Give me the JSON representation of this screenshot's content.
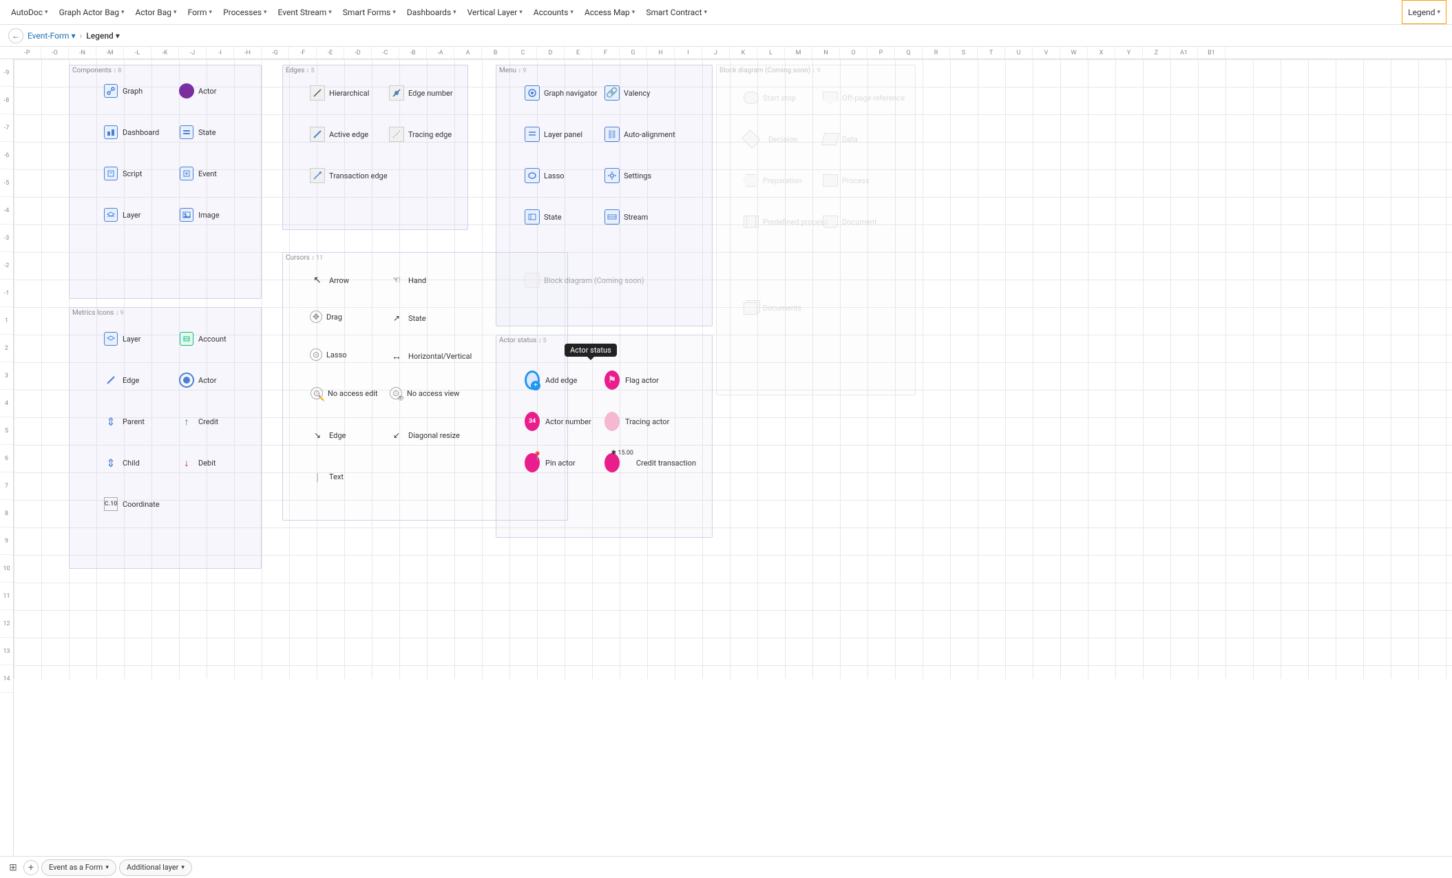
{
  "nav": {
    "items": [
      {
        "label": "AutoDoc",
        "id": "autodoc"
      },
      {
        "label": "Graph Actor Bag",
        "id": "graph-actor-bag"
      },
      {
        "label": "Actor Bag",
        "id": "actor-bag"
      },
      {
        "label": "Form",
        "id": "form"
      },
      {
        "label": "Processes",
        "id": "processes"
      },
      {
        "label": "Event Stream",
        "id": "event-stream"
      },
      {
        "label": "Smart Forms",
        "id": "smart-forms"
      },
      {
        "label": "Dashboards",
        "id": "dashboards"
      },
      {
        "label": "Vertical Layer",
        "id": "vertical-layer"
      },
      {
        "label": "Accounts",
        "id": "accounts"
      },
      {
        "label": "Access Map",
        "id": "access-map"
      },
      {
        "label": "Smart Contract",
        "id": "smart-contract"
      },
      {
        "label": "Legend",
        "id": "legend",
        "active": true
      }
    ]
  },
  "breadcrumb": {
    "back_label": "←",
    "parent": "Event-Form",
    "current": "Legend"
  },
  "columns": [
    "-P",
    "-O",
    "-N",
    "-M",
    "-L",
    "-K",
    "-J",
    "-I",
    "-H",
    "-G",
    "-F",
    "-E",
    "-D",
    "-C",
    "-B",
    "-A",
    "A",
    "B",
    "C",
    "D",
    "E",
    "F",
    "G",
    "H",
    "I",
    "J",
    "K",
    "L",
    "M",
    "N",
    "O",
    "P",
    "Q",
    "R",
    "S",
    "T",
    "U",
    "V",
    "W",
    "X",
    "Y",
    "Z",
    "A1",
    "B1"
  ],
  "rows": [
    "-9",
    "-8",
    "-7",
    "-6",
    "-5",
    "-4",
    "-3",
    "-2",
    "-1",
    "1",
    "2",
    "3",
    "4",
    "5",
    "6",
    "7",
    "8",
    "9",
    "10",
    "11",
    "12",
    "13",
    "14"
  ],
  "sections": {
    "components": {
      "title": "Components",
      "num": "8",
      "items": [
        {
          "icon": "graph",
          "label": "Graph"
        },
        {
          "icon": "actor-purple",
          "label": "Actor"
        },
        {
          "icon": "dashboard",
          "label": "Dashboard"
        },
        {
          "icon": "state",
          "label": "State"
        },
        {
          "icon": "script",
          "label": "Script"
        },
        {
          "icon": "event",
          "label": "Event"
        },
        {
          "icon": "layer",
          "label": "Layer"
        },
        {
          "icon": "image",
          "label": "Image"
        }
      ]
    },
    "edges": {
      "title": "Edges",
      "num": "5",
      "items": [
        {
          "icon": "hierarchical",
          "label": "Hierarchical"
        },
        {
          "icon": "edge-number",
          "label": "Edge number"
        },
        {
          "icon": "active-edge",
          "label": "Active edge"
        },
        {
          "icon": "tracing-edge",
          "label": "Tracing edge"
        },
        {
          "icon": "transaction-edge",
          "label": "Transaction edge"
        }
      ]
    },
    "menu": {
      "title": "Menu",
      "num": "9",
      "items": [
        {
          "icon": "graph-navigator",
          "label": "Graph navigator"
        },
        {
          "icon": "valency",
          "label": "Valency"
        },
        {
          "icon": "layer-panel",
          "label": "Layer panel"
        },
        {
          "icon": "auto-alignment",
          "label": "Auto-alignment"
        },
        {
          "icon": "lasso",
          "label": "Lasso"
        },
        {
          "icon": "settings",
          "label": "Settings"
        },
        {
          "icon": "state-menu",
          "label": "State"
        },
        {
          "icon": "stream",
          "label": "Stream"
        },
        {
          "icon": "block-diagram-coming",
          "label": "Block diagram (Coming soon)"
        }
      ]
    },
    "block_diagram": {
      "title": "Block diagram (Coming soon)",
      "num": "9",
      "items": [
        {
          "label": "Start stop"
        },
        {
          "label": "Off-page reference"
        },
        {
          "label": "Decision"
        },
        {
          "label": "Data"
        },
        {
          "label": "Preparation"
        },
        {
          "label": "Process"
        },
        {
          "label": "Predefined process"
        },
        {
          "label": "Document"
        },
        {
          "label": "Documents"
        }
      ]
    },
    "metrics": {
      "title": "Metrics Icons",
      "num": "9",
      "items": [
        {
          "icon": "layer-m",
          "label": "Layer"
        },
        {
          "icon": "account",
          "label": "Account"
        },
        {
          "icon": "edge-m",
          "label": "Edge"
        },
        {
          "icon": "actor-m",
          "label": "Actor"
        },
        {
          "icon": "parent",
          "label": "Parent"
        },
        {
          "icon": "credit",
          "label": "Credit"
        },
        {
          "icon": "child",
          "label": "Child"
        },
        {
          "icon": "debit",
          "label": "Debit"
        },
        {
          "icon": "coordinate",
          "label": "Coordinate"
        }
      ]
    },
    "cursors": {
      "title": "Cursors",
      "num": "11",
      "items": [
        {
          "icon": "arrow",
          "label": "Arrow"
        },
        {
          "icon": "hand",
          "label": "Hand"
        },
        {
          "icon": "drag",
          "label": "Drag"
        },
        {
          "icon": "state-cur",
          "label": "State"
        },
        {
          "icon": "lasso-cur",
          "label": "Lasso"
        },
        {
          "icon": "horiz-vert",
          "label": "Horizontal/Vertical"
        },
        {
          "icon": "no-access-edit",
          "label": "No access edit"
        },
        {
          "icon": "no-access-view",
          "label": "No access view"
        },
        {
          "icon": "edge-cur",
          "label": "Edge"
        },
        {
          "icon": "diagonal-resize",
          "label": "Diagonal resize"
        },
        {
          "icon": "text-cur",
          "label": "Text"
        }
      ]
    },
    "actor_status": {
      "title": "Actor status",
      "num": "5",
      "tooltip": "Actor status",
      "items": [
        {
          "icon": "add-edge",
          "label": "Add edge"
        },
        {
          "icon": "flag-actor",
          "label": "Flag actor"
        },
        {
          "icon": "actor-number",
          "label": "Actor number"
        },
        {
          "icon": "tracing-actor",
          "label": "Tracing actor"
        },
        {
          "icon": "pin-actor",
          "label": "Pin actor"
        },
        {
          "icon": "credit-transaction",
          "label": "Credit transaction"
        }
      ]
    }
  },
  "bottom_tabs": {
    "event_as_form": "Event as a Form",
    "additional_layer": "Additional layer"
  }
}
